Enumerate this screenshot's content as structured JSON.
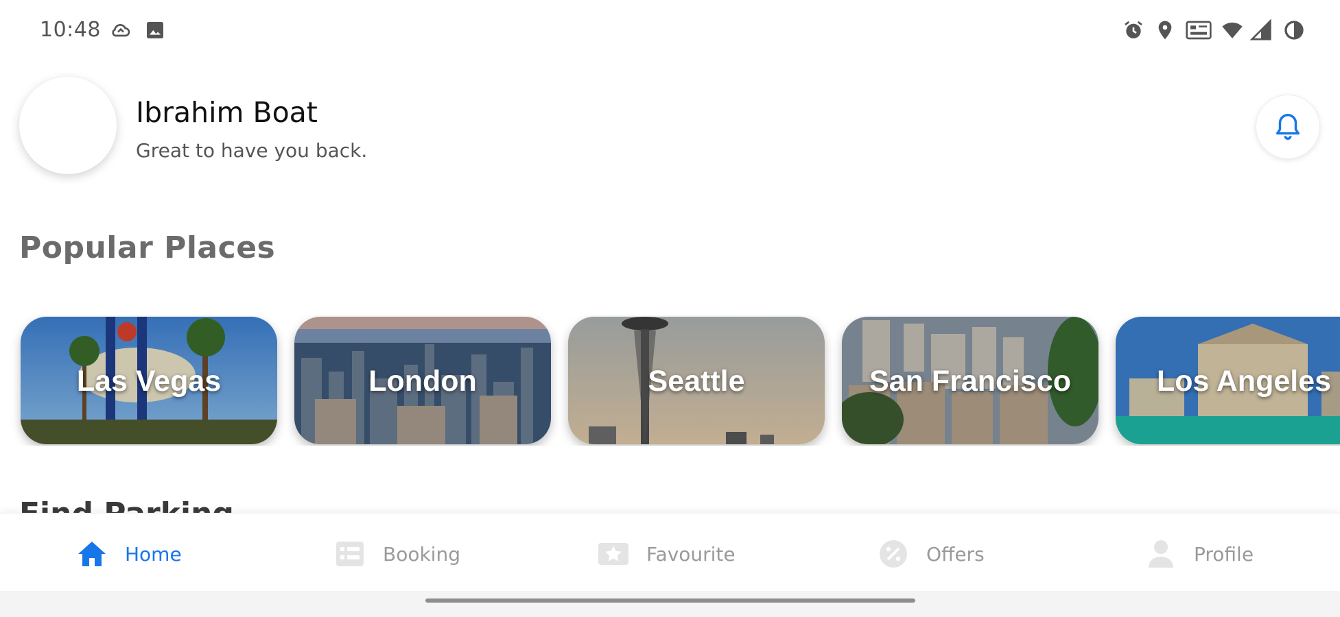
{
  "status_bar": {
    "time": "10:48",
    "left_icons": [
      "cloud-sync-icon",
      "image-icon"
    ],
    "right_icons": [
      "alarm-icon",
      "location-icon",
      "nfc-icon",
      "wifi-icon",
      "signal-icon",
      "battery-icon"
    ]
  },
  "header": {
    "user_name": "Ibrahim Boat",
    "greeting": "Great to have you back.",
    "notification_icon": "bell-icon"
  },
  "colors": {
    "accent": "#1877e8",
    "inactive": "#9a9a9a",
    "section_title": "#6b6b6b"
  },
  "popular_places": {
    "title": "Popular Places",
    "items": [
      {
        "label": "Las Vegas"
      },
      {
        "label": "London"
      },
      {
        "label": "Seattle"
      },
      {
        "label": "San Francisco"
      },
      {
        "label": "Los Angeles"
      }
    ]
  },
  "find_parking": {
    "title": "Find Parking"
  },
  "bottom_nav": {
    "items": [
      {
        "label": "Home",
        "icon": "home-icon",
        "active": true
      },
      {
        "label": "Booking",
        "icon": "list-icon",
        "active": false
      },
      {
        "label": "Favourite",
        "icon": "star-icon",
        "active": false
      },
      {
        "label": "Offers",
        "icon": "percent-icon",
        "active": false
      },
      {
        "label": "Profile",
        "icon": "person-icon",
        "active": false
      }
    ]
  }
}
